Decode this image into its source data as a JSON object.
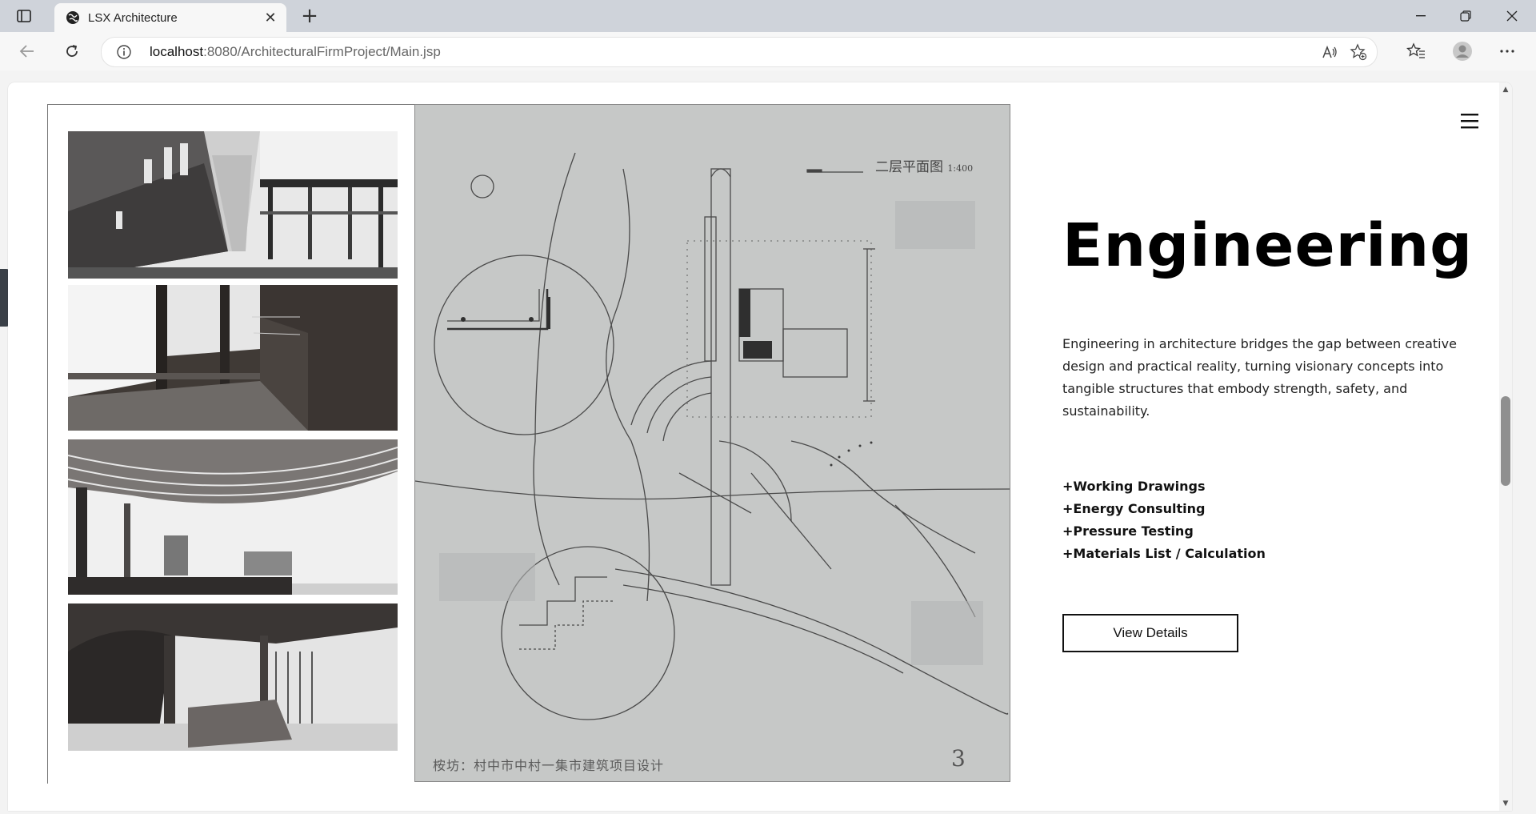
{
  "browser": {
    "tab_title": "LSX Architecture",
    "url_host": "localhost",
    "url_rest": ":8080/ArchitecturalFirmProject/Main.jsp",
    "new_tab_glyph": "+",
    "close_glyph": "✕"
  },
  "page": {
    "heading": "Engineering",
    "description": "Engineering in architecture bridges the gap between creative design and practical reality, turning visionary concepts into tangible structures that embody strength, safety, and sustainability.",
    "services": [
      "+Working Drawings",
      "+Energy Consulting",
      "+Pressure Testing",
      "+Materials List / Calculation"
    ],
    "button_label": "View Details",
    "menu_icon": "hamburger-menu-icon"
  },
  "drawing": {
    "title": "二层平面图",
    "scale": "1:400",
    "caption": "桉坊：村中市中村一集市建筑项目设计",
    "page_number": "3"
  },
  "colors": {
    "accent": "#000000",
    "plan_paper": "#c4c6c5",
    "chrome": "#cfd3da"
  }
}
